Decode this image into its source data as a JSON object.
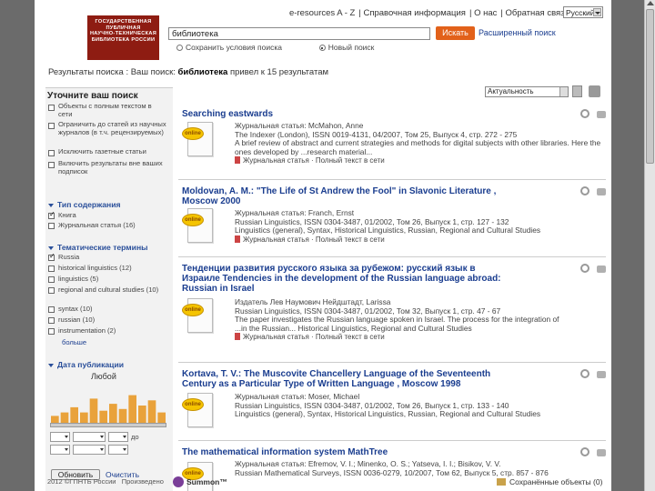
{
  "header": {
    "logo_lines": [
      "ГОСУДАРСТВЕННАЯ",
      "ПУБЛИЧНАЯ",
      "НАУЧНО-ТЕХНИЧЕСКАЯ",
      "БИБЛИОТЕКА РОССИИ"
    ],
    "top_links": [
      "e-resources A - Z",
      "Справочная информация",
      "О нас",
      "Обратная связь"
    ],
    "language": "Русский",
    "search_value": "библиотека",
    "search_button": "Искать",
    "advanced_search": "Расширенный поиск",
    "radio_options": [
      {
        "label": "Сохранить условия поиска",
        "checked": false
      },
      {
        "label": "Новый поиск",
        "checked": true
      }
    ]
  },
  "results_header": {
    "prefix": "Результаты поиска : Ваш поиск:",
    "query": "библиотека",
    "suffix": "привел к 15 результатам"
  },
  "toolbar": {
    "sort_value": "Актуальность"
  },
  "refine": {
    "title": "Уточните ваш поиск",
    "options": [
      {
        "label": "Объекты с полным текстом в сети",
        "checked": false
      },
      {
        "label": "Ограничить до статей из научных журналов (в т.ч. рецензируемых)",
        "checked": false
      },
      {
        "label": "Исключить газетные статьи",
        "checked": false
      },
      {
        "label": "Включить результаты вне ваших подписок",
        "checked": false
      }
    ],
    "content_type_title": "Тип содержания",
    "content_types": [
      {
        "label": "Книга",
        "checked": true
      },
      {
        "label": "Журнальная статья (16)",
        "checked": false
      }
    ],
    "subjects_title": "Тематические термины",
    "subjects": [
      {
        "label": "Russia",
        "checked": true
      },
      {
        "label": "historical linguistics (12)",
        "checked": false
      },
      {
        "label": "linguistics (5)",
        "checked": false
      },
      {
        "label": "regional and cultural studies (10)",
        "checked": false
      },
      {
        "label": "syntax (10)",
        "checked": false
      },
      {
        "label": "russian (10)",
        "checked": false
      },
      {
        "label": "instrumentation (2)",
        "checked": false
      }
    ],
    "more_link": "больше",
    "date_title": "Дата публикации",
    "date_any": "Любой",
    "date_to": "до",
    "histogram": [
      0.2,
      0.3,
      0.45,
      0.3,
      0.7,
      0.35,
      0.55,
      0.4,
      0.8,
      0.5,
      0.65,
      0.3
    ],
    "refresh_button": "Обновить",
    "clear_link": "Очистить"
  },
  "results": [
    {
      "title": "Searching eastwards",
      "badge": "online",
      "lines": [
        "Журнальная статья: McMahon, Anne",
        "The Indexer (London), ISSN 0019-4131, 04/2007, Том 25, Выпуск 4, стр. 272 - 275",
        "A brief review of abstract and current strategies and methods for digital subjects with other libraries. Here the",
        "ones developed by ...research material..."
      ],
      "links": "Журнальная статья · Полный текст в сети"
    },
    {
      "title": "Moldovan, A. M.: \"The Life of St Andrew the Fool\" in Slavonic Literature , Moscow 2000",
      "badge": "online",
      "lines": [
        "Журнальная статья: Franch, Ernst",
        "Russian Linguistics, ISSN 0304-3487, 01/2002, Том 26, Выпуск 1, стр. 127 - 132",
        "Linguistics (general), Syntax, Historical Linguistics, Russian, Regional and Cultural Studies"
      ],
      "links": "Журнальная статья · Полный текст в сети"
    },
    {
      "title": "Тенденции развития русского языка за рубежом: русский язык в Израиле Tendencies in the development of the Russian language abroad: Russian in Israel",
      "badge": "online",
      "lines": [
        "Издатель Лев Наумович Нейдштадт, Larissa",
        "Russian Linguistics, ISSN 0304-3487, 01/2002, Том 32, Выпуск 1, стр. 47 - 67",
        "The paper investigates the Russian language spoken in Israel. The process for the integration of",
        "...in the Russian... Historical Linguistics, Regional and Cultural Studies"
      ],
      "links": "Журнальная статья · Полный текст в сети"
    },
    {
      "title": "Kortava, T. V.: The Muscovite Chancellery Language of the Seventeenth Century as a Particular Type of Written Language , Moscow 1998",
      "badge": "online",
      "lines": [
        "Журнальная статья: Moser, Michael",
        "Russian Linguistics, ISSN 0304-3487, 01/2002, Том 26, Выпуск 1, стр. 133 - 140",
        "Linguistics (general), Syntax, Historical Linguistics, Russian, Regional and Cultural Studies"
      ],
      "links": "Журнальная статья · Полный текст в сети"
    },
    {
      "title": "The mathematical information system MathTree",
      "badge": "online",
      "lines": [
        "Журнальная статья: Efremov, V. I.; Minenko, O. S.; Yatseva, I. I.; Bisikov, V. V.",
        "Russian Mathematical Surveys, ISSN 0036-0279, 10/2007, Том 62, Выпуск 5, стр. 857 - 876"
      ],
      "links": ""
    }
  ],
  "footer": {
    "copyright": "2012 ©ГПНТБ России",
    "powered": "Произведено",
    "summon": "Summon™",
    "saved": "Сохранённые объекты (0)"
  }
}
